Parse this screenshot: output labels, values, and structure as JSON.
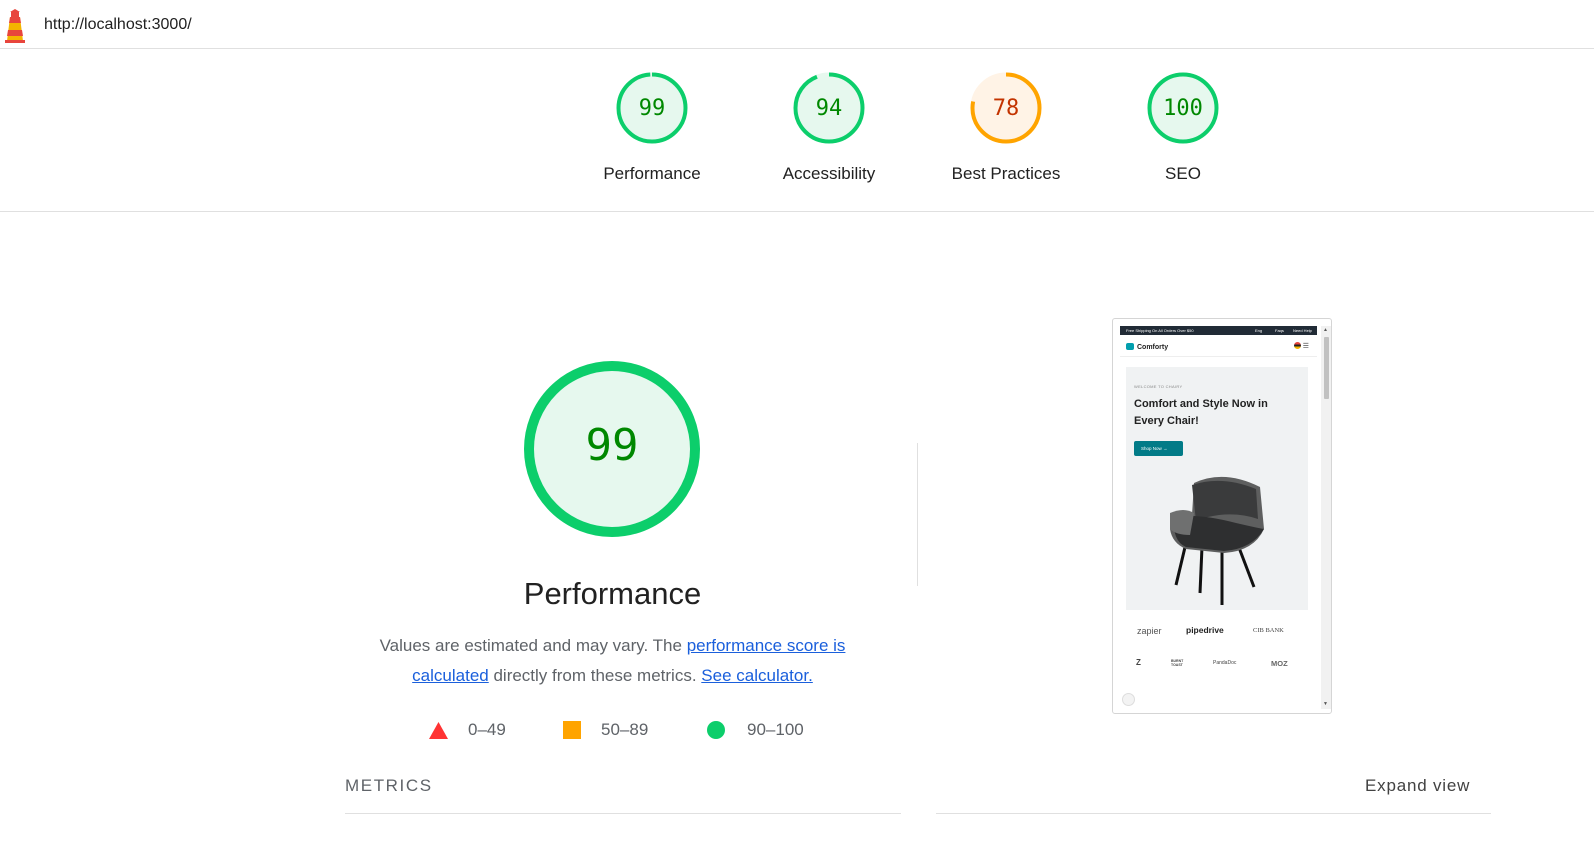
{
  "topbar": {
    "url": "http://localhost:3000/",
    "logo_icon": "lighthouse-icon"
  },
  "colors": {
    "pass": "#0cce6b",
    "pass_text": "#008800",
    "pass_fill": "#e6f8ee",
    "average": "#ffa400",
    "average_text": "#c33300",
    "average_fill": "#fff3e6",
    "fail": "#ff3333",
    "link": "#1a5fdc"
  },
  "categories": [
    {
      "score": 99,
      "label": "Performance",
      "rating": "pass"
    },
    {
      "score": 94,
      "label": "Accessibility",
      "rating": "pass"
    },
    {
      "score": 78,
      "label": "Best Practices",
      "rating": "average"
    },
    {
      "score": 100,
      "label": "SEO",
      "rating": "pass"
    }
  ],
  "performance": {
    "score": "99",
    "title": "Performance",
    "desc_prefix": "Values are estimated and may vary. The ",
    "desc_link1": "performance score is calculated",
    "desc_middle": " directly from these metrics. ",
    "desc_link2": "See calculator."
  },
  "legend": [
    {
      "icon": "triangle-icon",
      "range": "0–49"
    },
    {
      "icon": "square-icon",
      "range": "50–89"
    },
    {
      "icon": "circle-icon",
      "range": "90–100"
    }
  ],
  "thumbnail": {
    "topbar_left": "Free Shipping On All Orders Over $50",
    "topbar_lang": "Eng",
    "topbar_faqs": "Faqs",
    "topbar_help": "Need Help",
    "brand": "Comforty",
    "welcome": "WELCOME TO CHAIRY",
    "headline": "Comfort and Style Now in Every Chair!",
    "shop_button": "Shop Now →",
    "logos": [
      "zapier",
      "pipedrive",
      "CIB BANK",
      "Z",
      "BURNT TOAST",
      "PandaDoc",
      "MOZ"
    ]
  },
  "metrics": {
    "title": "METRICS",
    "expand": "Expand view"
  }
}
